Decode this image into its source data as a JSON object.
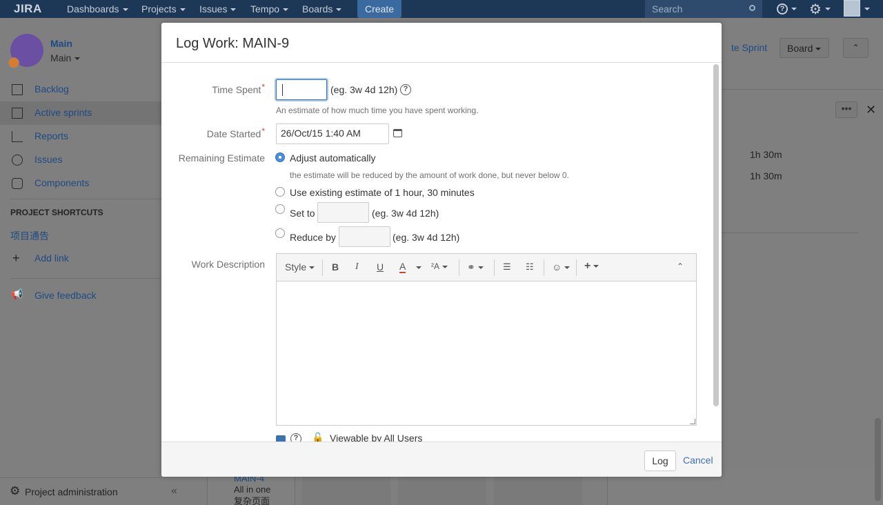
{
  "topnav": {
    "logo": "JIRA",
    "items": [
      {
        "label": "Dashboards"
      },
      {
        "label": "Projects"
      },
      {
        "label": "Issues"
      },
      {
        "label": "Tempo"
      },
      {
        "label": "Boards"
      }
    ],
    "create_label": "Create",
    "search_placeholder": "Search"
  },
  "sidebar": {
    "project_name": "Main",
    "project_sub": "Main",
    "items": [
      {
        "label": "Backlog"
      },
      {
        "label": "Active sprints"
      },
      {
        "label": "Reports"
      },
      {
        "label": "Issues"
      },
      {
        "label": "Components"
      }
    ],
    "shortcuts_heading": "PROJECT SHORTCUTS",
    "shortcut_link": "项目通告",
    "add_link": "Add link",
    "give_feedback": "Give feedback",
    "project_admin": "Project administration"
  },
  "background": {
    "sprint_link": "te Sprint",
    "board_label": "Board",
    "values": [
      "1h 30m",
      "1h 30m"
    ],
    "card_key": "MAIN-4",
    "card_title_1": "All in one",
    "card_title_2": "复杂页面"
  },
  "dialog": {
    "title": "Log Work:  MAIN-9",
    "time_spent": {
      "label": "Time Spent",
      "value": "",
      "hint": "(eg. 3w 4d 12h)",
      "description": "An estimate of how much time you have spent working."
    },
    "date_started": {
      "label": "Date Started",
      "value": "26/Oct/15 1:40 AM"
    },
    "remaining_estimate": {
      "label": "Remaining Estimate",
      "options": [
        {
          "label": "Adjust automatically",
          "selected": true
        },
        {
          "label": "Use existing estimate of 1 hour, 30 minutes",
          "selected": false
        },
        {
          "label": "Set to",
          "selected": false
        },
        {
          "label": "Reduce by",
          "selected": false
        }
      ],
      "auto_description": "the estimate will be reduced by the amount of work done, but never below 0.",
      "set_hint": "(eg. 3w 4d 12h)",
      "reduce_hint": "(eg. 3w 4d 12h)"
    },
    "work_description": {
      "label": "Work Description",
      "style_label": "Style",
      "value": ""
    },
    "visibility_label": "Viewable by All Users",
    "log_button": "Log",
    "cancel_link": "Cancel"
  },
  "colors": {
    "nav_bg": "#1d3757",
    "link": "#3b73af",
    "required": "#d04437",
    "radio_selected": "#4a8fdd"
  }
}
